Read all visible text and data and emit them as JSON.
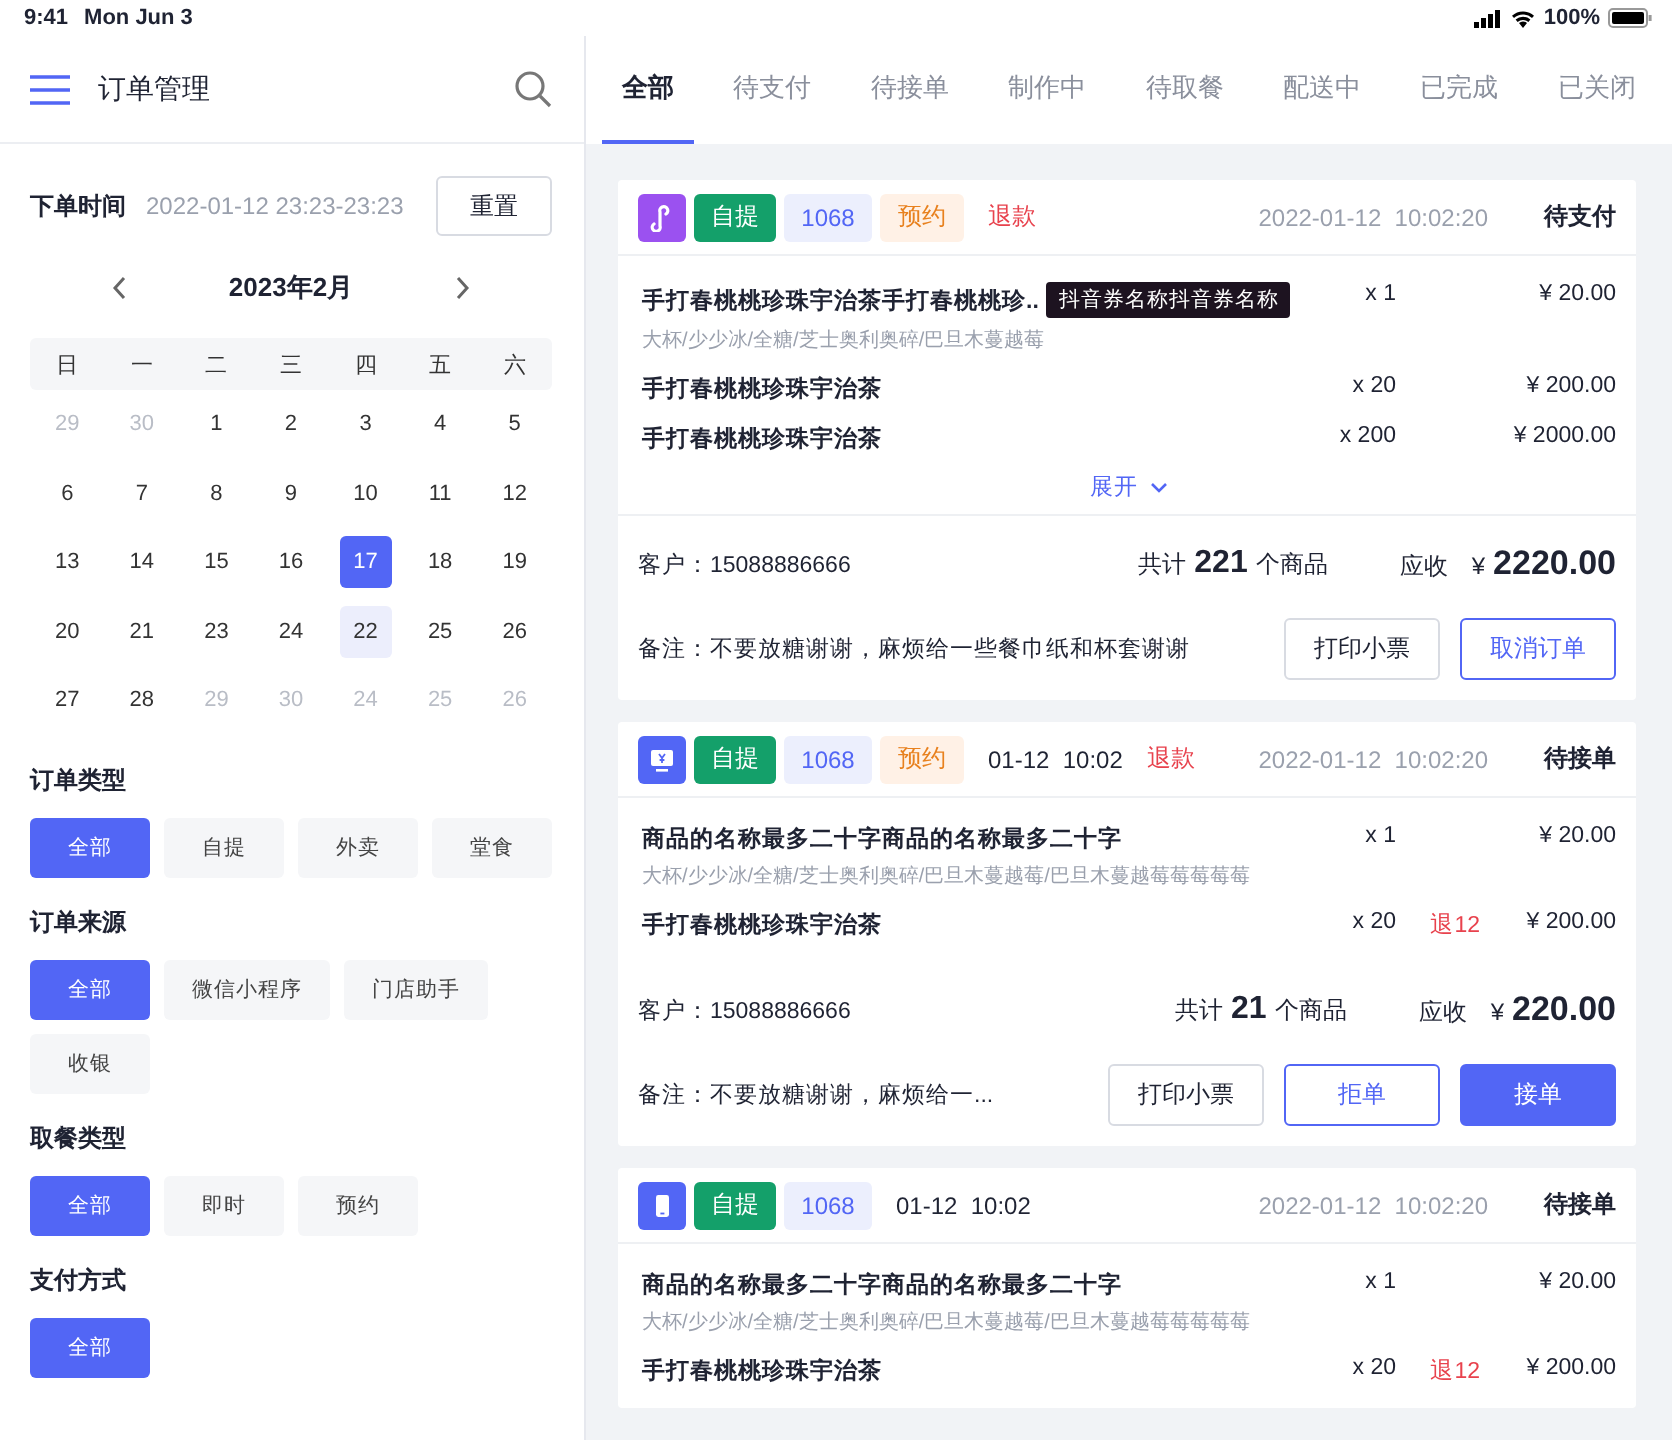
{
  "status_bar": {
    "time": "9:41",
    "date": "Mon Jun 3",
    "battery": "100%"
  },
  "sidebar": {
    "title": "订单管理",
    "time_filter": {
      "label": "下单时间",
      "value": "2022-01-12 23:23-23:23",
      "reset": "重置"
    },
    "calendar": {
      "month": "2023年2月",
      "weekdays": [
        "日",
        "一",
        "二",
        "三",
        "四",
        "五",
        "六"
      ],
      "weeks": [
        [
          {
            "day": "29",
            "muted": true,
            "selected": false,
            "highlighted": false
          },
          {
            "day": "30",
            "muted": true,
            "selected": false,
            "highlighted": false
          },
          {
            "day": "1",
            "muted": false,
            "selected": false,
            "highlighted": false
          },
          {
            "day": "2",
            "muted": false,
            "selected": false,
            "highlighted": false
          },
          {
            "day": "3",
            "muted": false,
            "selected": false,
            "highlighted": false
          },
          {
            "day": "4",
            "muted": false,
            "selected": false,
            "highlighted": false
          },
          {
            "day": "5",
            "muted": false,
            "selected": false,
            "highlighted": false
          }
        ],
        [
          {
            "day": "6",
            "muted": false,
            "selected": false,
            "highlighted": false
          },
          {
            "day": "7",
            "muted": false,
            "selected": false,
            "highlighted": false
          },
          {
            "day": "8",
            "muted": false,
            "selected": false,
            "highlighted": false
          },
          {
            "day": "9",
            "muted": false,
            "selected": false,
            "highlighted": false
          },
          {
            "day": "10",
            "muted": false,
            "selected": false,
            "highlighted": false
          },
          {
            "day": "11",
            "muted": false,
            "selected": false,
            "highlighted": false
          },
          {
            "day": "12",
            "muted": false,
            "selected": false,
            "highlighted": false
          }
        ],
        [
          {
            "day": "13",
            "muted": false,
            "selected": false,
            "highlighted": false
          },
          {
            "day": "14",
            "muted": false,
            "selected": false,
            "highlighted": false
          },
          {
            "day": "15",
            "muted": false,
            "selected": false,
            "highlighted": false
          },
          {
            "day": "16",
            "muted": false,
            "selected": false,
            "highlighted": false
          },
          {
            "day": "17",
            "muted": false,
            "selected": true,
            "highlighted": false
          },
          {
            "day": "18",
            "muted": false,
            "selected": false,
            "highlighted": false
          },
          {
            "day": "19",
            "muted": false,
            "selected": false,
            "highlighted": false
          }
        ],
        [
          {
            "day": "20",
            "muted": false,
            "selected": false,
            "highlighted": false
          },
          {
            "day": "21",
            "muted": false,
            "selected": false,
            "highlighted": false
          },
          {
            "day": "23",
            "muted": false,
            "selected": false,
            "highlighted": false
          },
          {
            "day": "24",
            "muted": false,
            "selected": false,
            "highlighted": false
          },
          {
            "day": "22",
            "muted": false,
            "selected": false,
            "highlighted": true
          },
          {
            "day": "25",
            "muted": false,
            "selected": false,
            "highlighted": false
          },
          {
            "day": "26",
            "muted": false,
            "selected": false,
            "highlighted": false
          }
        ],
        [
          {
            "day": "27",
            "muted": false,
            "selected": false,
            "highlighted": false
          },
          {
            "day": "28",
            "muted": false,
            "selected": false,
            "highlighted": false
          },
          {
            "day": "29",
            "muted": true,
            "selected": false,
            "highlighted": false
          },
          {
            "day": "30",
            "muted": true,
            "selected": false,
            "highlighted": false
          },
          {
            "day": "24",
            "muted": true,
            "selected": false,
            "highlighted": false
          },
          {
            "day": "25",
            "muted": true,
            "selected": false,
            "highlighted": false
          },
          {
            "day": "26",
            "muted": true,
            "selected": false,
            "highlighted": false
          }
        ]
      ]
    },
    "filters": [
      {
        "title": "订单类型",
        "options": [
          {
            "label": "全部",
            "selected": true
          },
          {
            "label": "自提",
            "selected": false
          },
          {
            "label": "外卖",
            "selected": false
          },
          {
            "label": "堂食",
            "selected": false
          }
        ]
      },
      {
        "title": "订单来源",
        "options": [
          {
            "label": "全部",
            "selected": true
          },
          {
            "label": "微信小程序",
            "selected": false
          },
          {
            "label": "门店助手",
            "selected": false
          },
          {
            "label": "收银",
            "selected": false
          }
        ]
      },
      {
        "title": "取餐类型",
        "options": [
          {
            "label": "全部",
            "selected": true
          },
          {
            "label": "即时",
            "selected": false
          },
          {
            "label": "预约",
            "selected": false
          }
        ]
      },
      {
        "title": "支付方式",
        "options": [
          {
            "label": "全部",
            "selected": true
          }
        ]
      }
    ]
  },
  "tabs": [
    {
      "label": "全部",
      "selected": true
    },
    {
      "label": "待支付",
      "selected": false
    },
    {
      "label": "待接单",
      "selected": false
    },
    {
      "label": "制作中",
      "selected": false
    },
    {
      "label": "待取餐",
      "selected": false
    },
    {
      "label": "配送中",
      "selected": false
    },
    {
      "label": "已完成",
      "selected": false
    },
    {
      "label": "已关闭",
      "selected": false
    }
  ],
  "orders": [
    {
      "kind": "miniprogram",
      "tags": [
        {
          "kind": "pickup",
          "text": "自提"
        },
        {
          "kind": "number",
          "text": "1068"
        },
        {
          "kind": "reserve",
          "text": "预约"
        }
      ],
      "refund": "退款",
      "created": "2022-01-12  10:02:20",
      "status": "待支付",
      "items": [
        {
          "name": "手打春桃桃珍珠宇治茶手打春桃桃珍..",
          "coupon": "抖音券名称抖音券名称",
          "specs": "大杯/少少冰/全糖/芝士奥利奥碎/巴旦木蔓越莓",
          "qty": "x 1",
          "price": "¥ 20.00"
        },
        {
          "name": "手打春桃桃珍珠宇治茶",
          "qty": "x 20",
          "price": "¥ 200.00"
        },
        {
          "name": "手打春桃桃珍珠宇治茶",
          "qty": "x 200",
          "price": "¥ 2000.00"
        }
      ],
      "expand": "展开",
      "footer": {
        "customer": "客户：15088886666",
        "total_prefix": "共计",
        "count": "221",
        "total_suffix": "个商品",
        "due_label": "应收",
        "currency": "¥",
        "due": "2220.00",
        "note": "备注：不要放糖谢谢，麻烦给一些餐巾纸和杯套谢谢",
        "buttons": [
          {
            "label": "打印小票",
            "kind": "default"
          },
          {
            "label": "取消订单",
            "kind": "outline"
          }
        ]
      }
    },
    {
      "kind": "pos",
      "tags": [
        {
          "kind": "pickup",
          "text": "自提"
        },
        {
          "kind": "number",
          "text": "1068"
        },
        {
          "kind": "reserve",
          "text": "预约"
        }
      ],
      "pickup_time": "01-12  10:02",
      "refund": "退款",
      "created": "2022-01-12  10:02:20",
      "status": "待接单",
      "items": [
        {
          "name": "商品的名称最多二十字商品的名称最多二十字",
          "specs": "大杯/少少冰/全糖/芝士奥利奥碎/巴旦木蔓越莓/巴旦木蔓越莓莓莓莓莓",
          "qty": "x 1",
          "price": "¥ 20.00"
        },
        {
          "name": "手打春桃桃珍珠宇治茶",
          "qty": "x 20",
          "refund": "退12",
          "price": "¥ 200.00"
        }
      ],
      "footer": {
        "customer": "客户：15088886666",
        "total_prefix": "共计",
        "count": "21",
        "total_suffix": "个商品",
        "due_label": "应收",
        "currency": "¥",
        "due": "220.00",
        "note": "备注：不要放糖谢谢，麻烦给一...",
        "buttons": [
          {
            "label": "打印小票",
            "kind": "default"
          },
          {
            "label": "拒单",
            "kind": "outline"
          },
          {
            "label": "接单",
            "kind": "primary"
          }
        ]
      }
    },
    {
      "kind": "phone",
      "tags": [
        {
          "kind": "pickup",
          "text": "自提"
        },
        {
          "kind": "number",
          "text": "1068"
        }
      ],
      "pickup_time": "01-12  10:02",
      "created": "2022-01-12  10:02:20",
      "status": "待接单",
      "items": [
        {
          "name": "商品的名称最多二十字商品的名称最多二十字",
          "specs": "大杯/少少冰/全糖/芝士奥利奥碎/巴旦木蔓越莓/巴旦木蔓越莓莓莓莓莓",
          "qty": "x 1",
          "price": "¥ 20.00"
        },
        {
          "name": "手打春桃桃珍珠宇治茶",
          "qty": "x 20",
          "refund": "退12",
          "price": "¥ 200.00"
        }
      ]
    }
  ]
}
